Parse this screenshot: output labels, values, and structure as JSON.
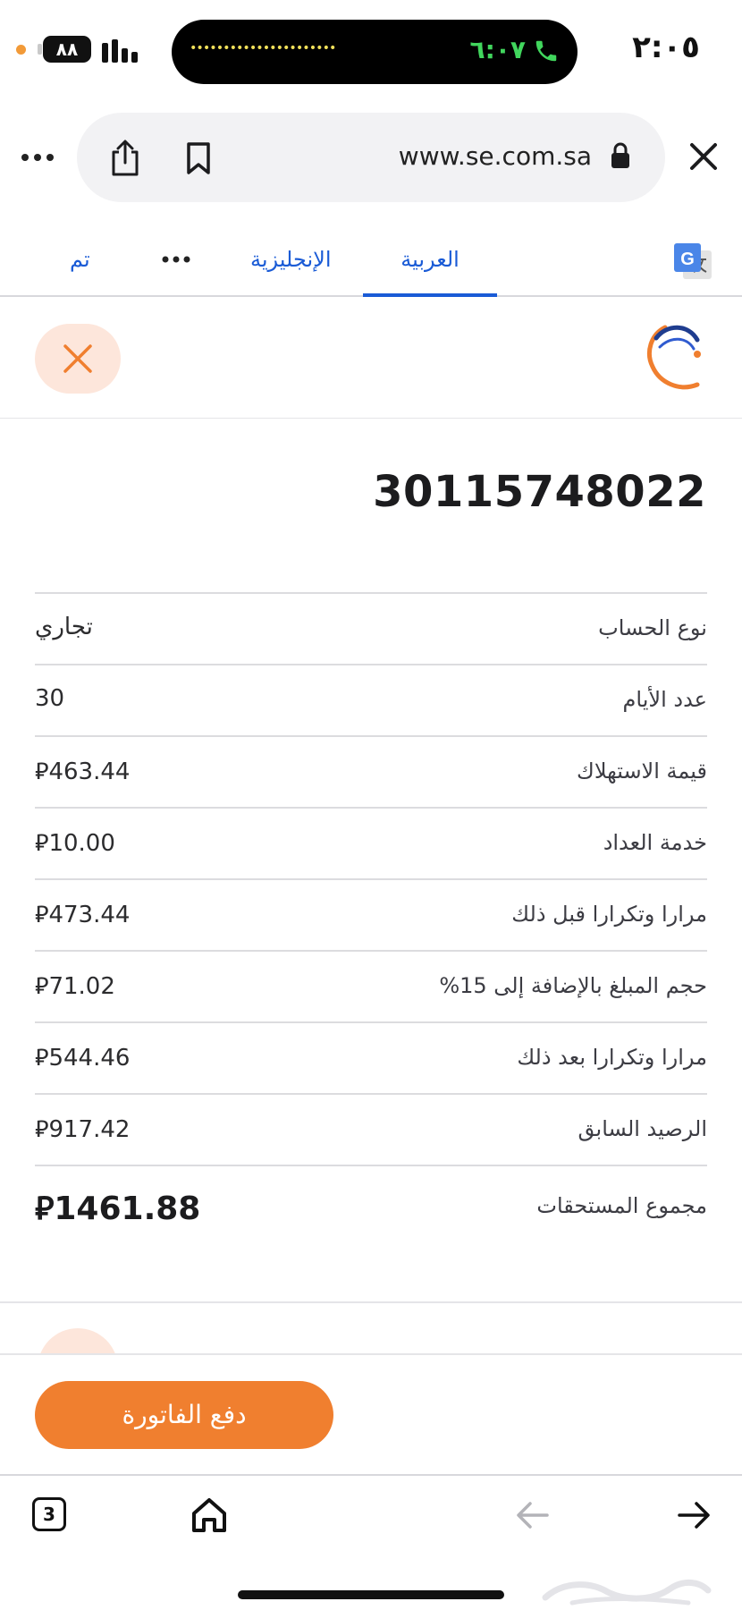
{
  "status_bar": {
    "time": "٢:٠٥",
    "battery": "٨٨",
    "call_timer": "٦:٠٧"
  },
  "browser": {
    "url": "www.se.com.sa"
  },
  "translate_bar": {
    "done_label": "تم",
    "english_label": "الإنجليزية",
    "arabic_label": "العربية"
  },
  "account": {
    "number": "30115748022",
    "rows": [
      {
        "label": "نوع الحساب",
        "value": "تجاري"
      },
      {
        "label": "عدد الأيام",
        "value": "30"
      },
      {
        "label": "قيمة الاستهلاك",
        "value": "⃁463.44"
      },
      {
        "label": "خدمة العداد",
        "value": "⃁10.00"
      },
      {
        "label": "مرارا وتكرارا قبل ذلك",
        "value": "⃁473.44"
      },
      {
        "label": "حجم المبلغ بالإضافة إلى 15%",
        "value": "⃁71.02"
      },
      {
        "label": "مرارا وتكرارا بعد ذلك",
        "value": "⃁544.46"
      },
      {
        "label": "الرصيد السابق",
        "value": "⃁917.42"
      }
    ],
    "total": {
      "label": "مجموع المستحقات",
      "value": "⃁1461.88"
    }
  },
  "actions": {
    "pay_label": "دفع الفاتورة"
  },
  "toolbar": {
    "tab_count": "3"
  },
  "colors": {
    "accent_orange": "#f07f2f",
    "link_blue": "#1a5bd6"
  }
}
